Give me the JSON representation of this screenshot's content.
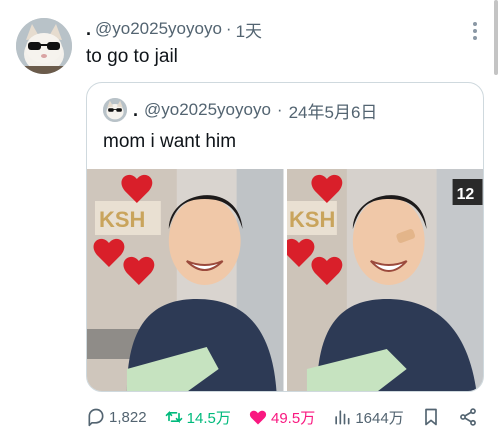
{
  "tweet": {
    "display_name": ".",
    "handle": "@yo2025yoyoyo",
    "separator": "·",
    "time": "1天",
    "text": "to go to jail",
    "avatar_icon": "cat-with-sunglasses-avatar"
  },
  "quoted_tweet": {
    "display_name": ".",
    "handle": "@yo2025yoyoyo",
    "separator": "·",
    "date": "24年5月6日",
    "text": "mom i want him",
    "avatar_icon": "cat-with-sunglasses-avatar",
    "photos": [
      {
        "sign_text": "KSH",
        "description_icon": "smiling-man-photo"
      },
      {
        "sign_text": "KSH",
        "description_icon": "smiling-man-photo",
        "corner_number": "12"
      }
    ]
  },
  "actions": {
    "replies": "1,822",
    "retweets": "14.5万",
    "likes": "49.5万",
    "views": "1644万"
  },
  "colors": {
    "retweet": "#00ba7c",
    "like": "#f91880",
    "muted": "#536471"
  }
}
